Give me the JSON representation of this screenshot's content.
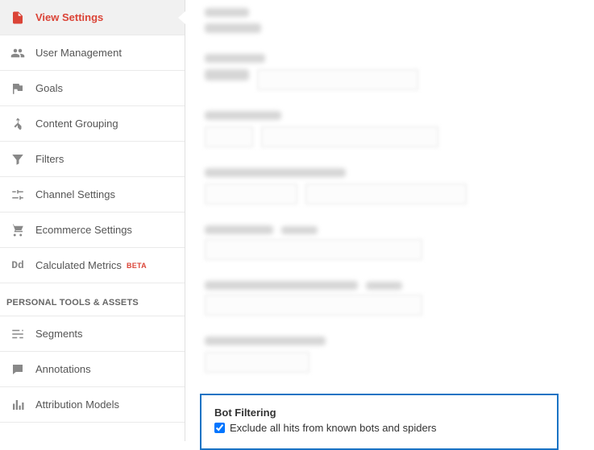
{
  "sidebar": {
    "items": [
      {
        "label": "View Settings"
      },
      {
        "label": "User Management"
      },
      {
        "label": "Goals"
      },
      {
        "label": "Content Grouping"
      },
      {
        "label": "Filters"
      },
      {
        "label": "Channel Settings"
      },
      {
        "label": "Ecommerce Settings"
      },
      {
        "label": "Calculated Metrics",
        "badge": "BETA"
      }
    ],
    "section_header": "PERSONAL TOOLS & ASSETS",
    "tools": [
      {
        "label": "Segments"
      },
      {
        "label": "Annotations"
      },
      {
        "label": "Attribution Models"
      }
    ]
  },
  "bot_filtering": {
    "title": "Bot Filtering",
    "checkbox_label": "Exclude all hits from known bots and spiders",
    "checked": true
  }
}
